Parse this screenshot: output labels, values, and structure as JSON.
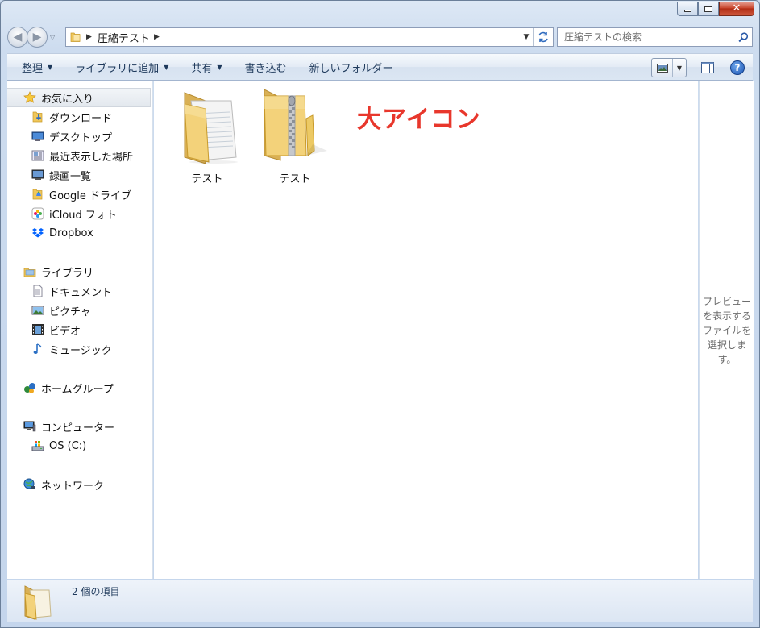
{
  "window": {
    "caption": {
      "minimize": "—",
      "maximize": "□",
      "close": "✕"
    }
  },
  "address": {
    "crumbs": [
      "圧縮テスト"
    ],
    "search_placeholder": "圧縮テストの検索"
  },
  "toolbar": {
    "organize": "整理",
    "add_to_library": "ライブラリに追加",
    "share": "共有",
    "burn": "書き込む",
    "new_folder": "新しいフォルダー"
  },
  "nav": {
    "favorites": {
      "label": "お気に入り",
      "items": [
        "ダウンロード",
        "デスクトップ",
        "最近表示した場所",
        "録画一覧",
        "Google ドライブ",
        "iCloud フォト",
        "Dropbox"
      ]
    },
    "libraries": {
      "label": "ライブラリ",
      "items": [
        "ドキュメント",
        "ピクチャ",
        "ビデオ",
        "ミュージック"
      ]
    },
    "homegroup": "ホームグループ",
    "computer": {
      "label": "コンピューター",
      "items": [
        "OS (C:)"
      ]
    },
    "network": "ネットワーク"
  },
  "content": {
    "files": [
      {
        "name": "テスト",
        "type": "folder"
      },
      {
        "name": "テスト",
        "type": "zip-folder"
      }
    ],
    "annotation": "大アイコン"
  },
  "preview": {
    "empty_text": "プレビューを表示するファイルを選択します。"
  },
  "status": {
    "item_count": "2 個の項目"
  },
  "colors": {
    "annotation": "#e8372c",
    "folder": "#f3d27a",
    "accent": "#1e395b"
  }
}
